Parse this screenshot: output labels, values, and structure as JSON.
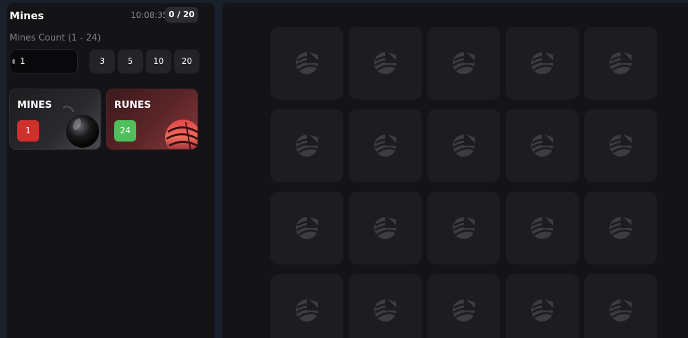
{
  "header": {
    "title": "Mines",
    "time": "10:08:35",
    "progress": "0 / 20"
  },
  "settings": {
    "label": "Mines Count (1 - 24)",
    "value": "1",
    "presets": [
      "3",
      "5",
      "10",
      "20"
    ]
  },
  "modes": [
    {
      "label": "MINES",
      "count": "1",
      "color": "#d0302b"
    },
    {
      "label": "RUNES",
      "count": "24",
      "color": "#4fbf5b"
    }
  ],
  "board": {
    "rows": 4,
    "cols": 5,
    "visible_tiles": 20,
    "tile_icon": "rune-logo-icon"
  }
}
